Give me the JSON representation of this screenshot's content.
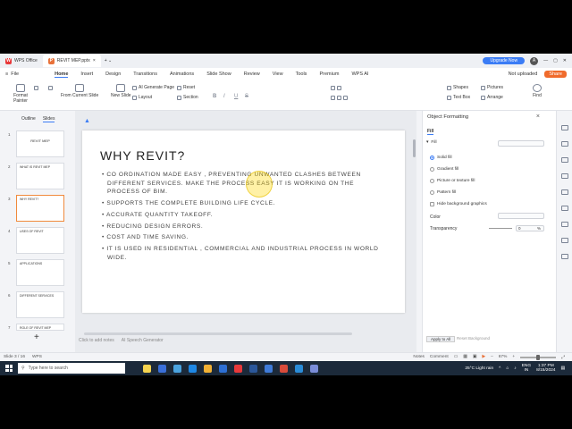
{
  "titlebar": {
    "tabs": [
      {
        "label": "WPS Office",
        "icon": "W"
      },
      {
        "label": "REVIT MEP.pptx",
        "icon": "P"
      }
    ],
    "upgrade_label": "Upgrade Now",
    "avatar_letter": "A"
  },
  "menubar": {
    "file_label": "File",
    "items": [
      "Home",
      "Insert",
      "Design",
      "Transitions",
      "Animations",
      "Slide Show",
      "Review",
      "View",
      "Tools",
      "Premium",
      "WPS AI"
    ],
    "not_uploaded": "Not uploaded",
    "share": "Share"
  },
  "ribbon": {
    "format_painter": "Format Painter",
    "from_current": "From Current Slide",
    "new_slide": "New Slide",
    "ai_generate": "AI Generate Page",
    "layout": "Layout",
    "reset": "Reset",
    "section": "Section",
    "shapes": "Shapes",
    "pictures": "Pictures",
    "text_box": "Text Box",
    "arrange": "Arrange",
    "find": "Find",
    "bold": "B",
    "italic": "I",
    "underline": "U",
    "strike": "S"
  },
  "left_panel": {
    "tabs": [
      "Outline",
      "Slides"
    ],
    "thumbs": [
      {
        "num": "1",
        "title": "REVIT MEP"
      },
      {
        "num": "2",
        "title": "WHAT IS REVIT MEP"
      },
      {
        "num": "3",
        "title": "WHY REVIT?"
      },
      {
        "num": "4",
        "title": "USES OF REVIT"
      },
      {
        "num": "5",
        "title": "APPLICATIONS"
      },
      {
        "num": "6",
        "title": "DIFFERENT SERVICES"
      },
      {
        "num": "7",
        "title": "ROLE OF REVIT MEP"
      }
    ],
    "add": "+"
  },
  "slide": {
    "title": "WHY REVIT?",
    "bullets": [
      "CO ORDINATION MADE EASY , PREVENTING UNWANTED CLASHES BETWEEN DIFFERENT SERVICES. MAKE THE PROCESS EASY IT IS WORKING ON THE PROCESS OF BIM.",
      "SUPPORTS THE COMPLETE BUILDING LIFE CYCLE.",
      "ACCURATE QUANTITY TAKEOFF.",
      "REDUCING DESIGN ERRORS.",
      "COST AND TIME SAVING.",
      "IT IS USED IN RESIDENTIAL , COMMERCIAL AND INDUSTRIAL PROCESS IN WORLD WIDE."
    ]
  },
  "notes": {
    "placeholder": "Click to add notes",
    "ai_speech": "AI Speech Generator"
  },
  "right_panel": {
    "title": "Object Formatting",
    "fill_tab": "Fill",
    "fill_section": "Fill",
    "options": [
      "Solid fill",
      "Gradient fill",
      "Picture or texture fill",
      "Pattern fill"
    ],
    "hide_bg": "Hide background graphics",
    "color_label": "Color",
    "transparency_label": "Transparency",
    "transparency_value": "0",
    "transparency_unit": "%",
    "apply_all": "Apply to All",
    "reset_bg": "Reset Background"
  },
  "statusbar": {
    "slide_info": "Slide 3 / 16",
    "wps": "WPS",
    "notes": "Notes",
    "comment": "Comment",
    "zoom": "67%"
  },
  "taskbar": {
    "search_placeholder": "Type here to search",
    "weather": "25°C  Light rain",
    "lang": "ENG",
    "region": "IN",
    "time": "1:37 PM",
    "date": "8/15/2024"
  }
}
